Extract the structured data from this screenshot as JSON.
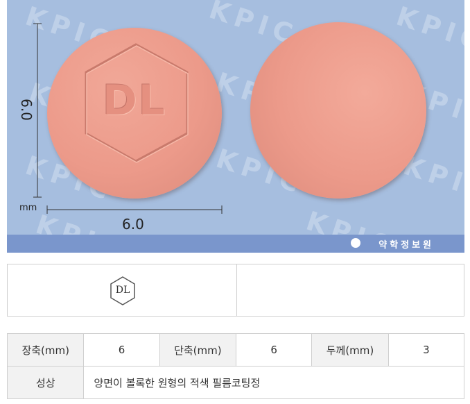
{
  "image": {
    "watermark_text": "KPIC",
    "front_imprint": "DL",
    "back_imprint": "",
    "tablet_color": "#ec9a8a",
    "background_color": "#a6bedf",
    "dimension_vertical": "6.0",
    "dimension_horizontal": "6.0",
    "dimension_unit": "mm",
    "source_label": "약학정보원"
  },
  "mark_table": {
    "front_mark": "DL",
    "back_mark": ""
  },
  "spec": {
    "length_label": "장축(mm)",
    "length_value": "6",
    "width_label": "단축(mm)",
    "width_value": "6",
    "thickness_label": "두께(mm)",
    "thickness_value": "3",
    "shape_label": "성상",
    "shape_value": "양면이 볼록한 원형의 적색 필름코팅정"
  }
}
